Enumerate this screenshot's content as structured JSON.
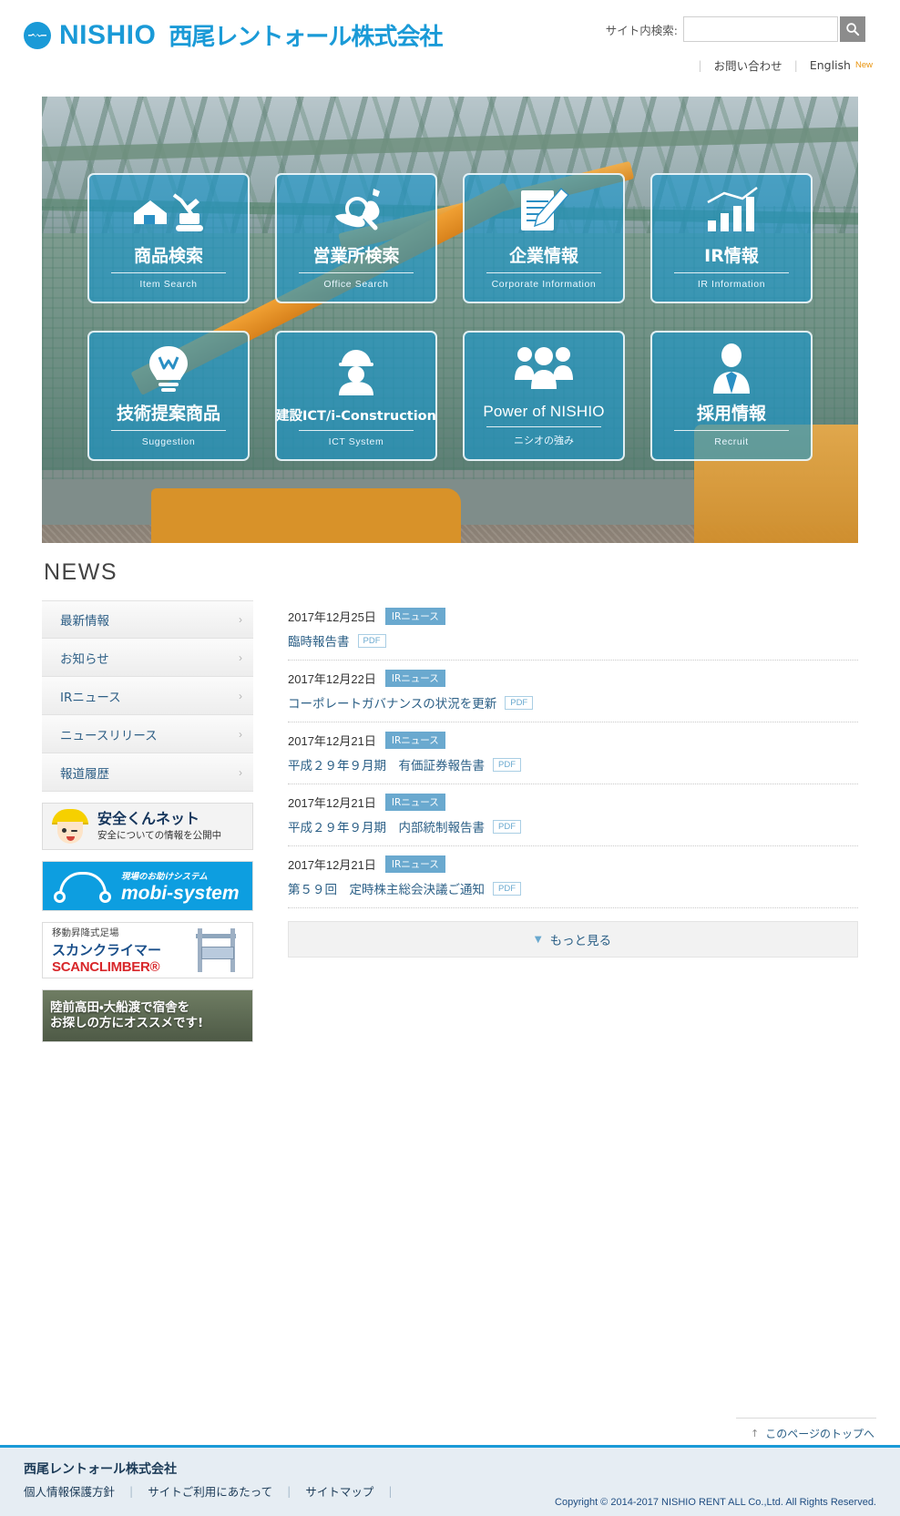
{
  "header": {
    "logo_en": "NISHIO",
    "logo_jp": "西尾レントォール株式会社",
    "search_label": "サイト内検索:",
    "search_value": "",
    "search_placeholder": "",
    "search_icon": "search-icon",
    "contact_label": "お問い合わせ",
    "english_label": "English",
    "english_badge": "New"
  },
  "hero": {
    "tiles": [
      {
        "title": "商品検索",
        "sub": "Item Search",
        "icon": "excavator-house-icon"
      },
      {
        "title": "営業所検索",
        "sub": "Office Search",
        "icon": "map-magnifier-icon"
      },
      {
        "title": "企業情報",
        "sub": "Corporate Information",
        "icon": "document-pencil-icon"
      },
      {
        "title": "IR情報",
        "sub": "IR Information",
        "icon": "bar-chart-icon"
      },
      {
        "title": "技術提案商品",
        "sub": "Suggestion",
        "icon": "lightbulb-icon"
      },
      {
        "title": "建設ICT/i-Construction",
        "sub": "ICT System",
        "icon": "worker-helmet-icon"
      },
      {
        "title": "Power of NISHIO",
        "sub": "ニシオの強み",
        "icon": "three-people-icon"
      },
      {
        "title": "採用情報",
        "sub": "Recruit",
        "icon": "businessman-icon"
      }
    ]
  },
  "news": {
    "heading": "NEWS",
    "side_items": [
      {
        "label": "最新情報"
      },
      {
        "label": "お知らせ"
      },
      {
        "label": "IRニュース"
      },
      {
        "label": "ニュースリリース"
      },
      {
        "label": "報道履歴"
      }
    ],
    "items": [
      {
        "date": "2017年12月25日",
        "category": "IRニュース",
        "title": "臨時報告書",
        "pdf": "PDF"
      },
      {
        "date": "2017年12月22日",
        "category": "IRニュース",
        "title": "コーポレートガバナンスの状況を更新",
        "pdf": "PDF"
      },
      {
        "date": "2017年12月21日",
        "category": "IRニュース",
        "title": "平成２９年９月期　有価証券報告書",
        "pdf": "PDF"
      },
      {
        "date": "2017年12月21日",
        "category": "IRニュース",
        "title": "平成２９年９月期　内部統制報告書",
        "pdf": "PDF"
      },
      {
        "date": "2017年12月21日",
        "category": "IRニュース",
        "title": "第５９回　定時株主総会決議ご通知",
        "pdf": "PDF"
      }
    ],
    "more_label": "もっと見る",
    "more_caret": "▼"
  },
  "banners": {
    "safety": {
      "title": "安全くんネット",
      "subtitle": "安全についての情報を公開中"
    },
    "mobi": {
      "tagline": "現場のお助けシステム",
      "title": "mobi-system"
    },
    "scan": {
      "top": "移動昇降式足場",
      "jp": "スカンクライマー",
      "en": "SCANCLIMBER®"
    },
    "rikuzen": {
      "line1": "陸前高田・大船渡で宿舎を",
      "line2": "お探しの方にオススメです!"
    }
  },
  "pagetop": {
    "label": "このページのトップへ",
    "arrow": "↑"
  },
  "footer": {
    "company": "西尾レントォール株式会社",
    "links": [
      {
        "label": "個人情報保護方針"
      },
      {
        "label": "サイトご利用にあたって"
      },
      {
        "label": "サイトマップ"
      }
    ],
    "copyright": "Copyright © 2014-2017 NISHIO RENT ALL Co.,Ltd. All Rights Reserved."
  },
  "colors": {
    "brand": "#1a9ad7",
    "tile": "#1696cd",
    "link": "#2b5f86",
    "badge": "#6aa9cf",
    "new": "#e8920a"
  }
}
